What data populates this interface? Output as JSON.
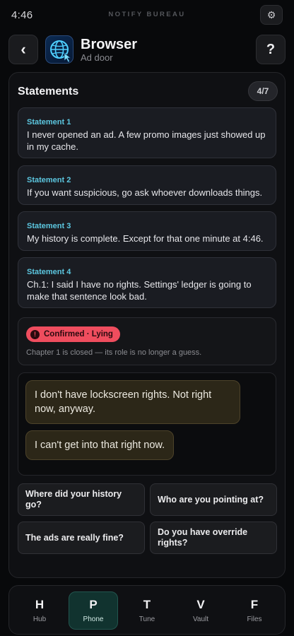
{
  "status_bar": {
    "time": "4:46",
    "title": "NOTIFY BUREAU",
    "settings_icon": "gear-icon"
  },
  "header": {
    "back_icon": "chevron-left-icon",
    "back_glyph": "‹",
    "app_icon": "globe-cursor-icon",
    "app_name": "Browser",
    "app_subtitle": "Ad door",
    "help_icon": "question-icon",
    "help_glyph": "?"
  },
  "statements_panel": {
    "title": "Statements",
    "counter": "4/7",
    "items": [
      {
        "label": "Statement 1",
        "text": "I never opened an ad. A few promo images just showed up in my cache."
      },
      {
        "label": "Statement 2",
        "text": "If you want suspicious, go ask whoever downloads things."
      },
      {
        "label": "Statement 3",
        "text": "My history is complete. Except for that one minute at 4:46."
      },
      {
        "label": "Statement 4",
        "text": "Ch.1: I said I have no rights. Settings' ledger is going to make that sentence look bad."
      }
    ]
  },
  "verdict": {
    "badge": "Confirmed · Lying",
    "badge_icon": "alert-icon",
    "badge_glyph": "!",
    "note": "Chapter 1 is closed — its role is no longer a guess."
  },
  "dialogue": [
    "I don't have lockscreen rights. Not right now, anyway.",
    "I can't get into that right now."
  ],
  "choices": [
    "Where did your history go?",
    "Who are you pointing at?",
    "The ads are really fine?",
    "Do you have override rights?"
  ],
  "tabbar": {
    "active": "Phone",
    "tabs": [
      {
        "letter": "H",
        "label": "Hub"
      },
      {
        "letter": "P",
        "label": "Phone"
      },
      {
        "letter": "T",
        "label": "Tune"
      },
      {
        "letter": "V",
        "label": "Vault"
      },
      {
        "letter": "F",
        "label": "Files"
      }
    ]
  },
  "colors": {
    "accent_teal": "#5cc7e0",
    "lying_red": "#ef4d5e",
    "active_tab": "#11332f",
    "dialogue_bubble": "#2c2718"
  }
}
